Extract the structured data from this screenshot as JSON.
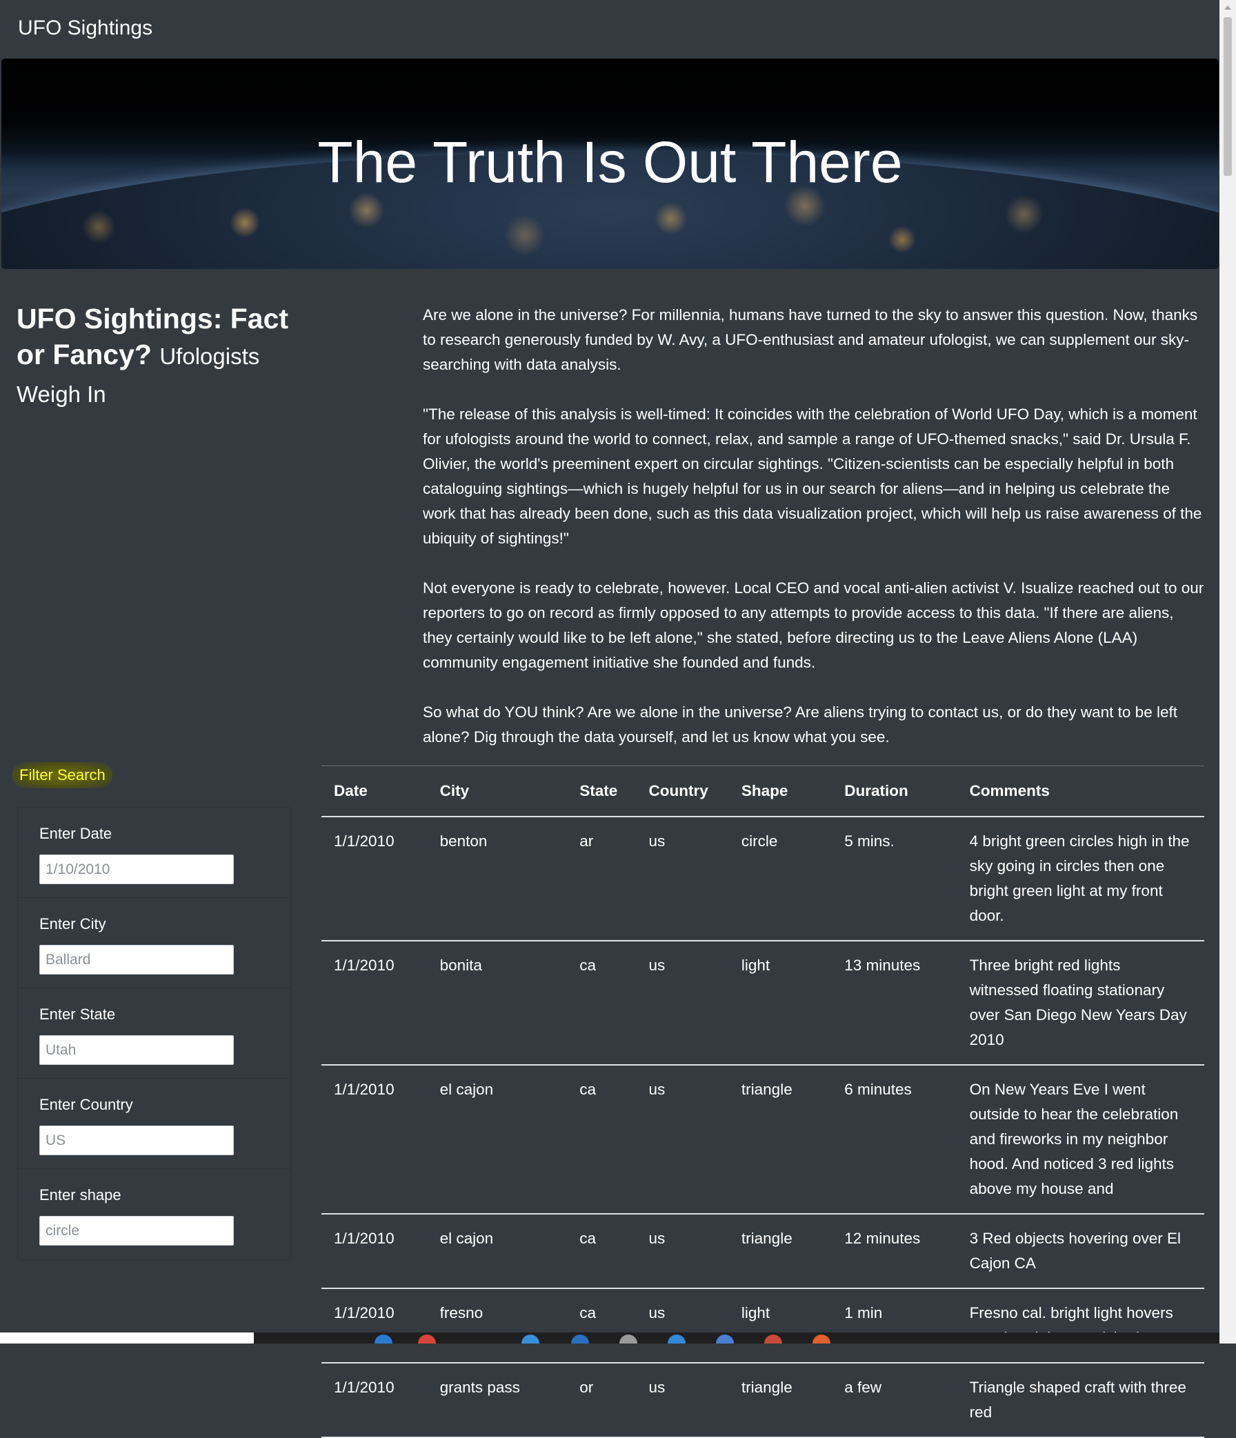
{
  "navbar": {
    "brand": "UFO Sightings"
  },
  "hero": {
    "title": "The Truth Is Out There"
  },
  "left": {
    "heading": "UFO Sightings: Fact or Fancy?",
    "subheading": "Ufologists Weigh In"
  },
  "article": {
    "paragraphs": [
      "Are we alone in the universe? For millennia, humans have turned to the sky to answer this question. Now, thanks to research generously funded by W. Avy, a UFO-enthusiast and amateur ufologist, we can supplement our sky-searching with data analysis.",
      "\"The release of this analysis is well-timed: It coincides with the celebration of World UFO Day, which is a moment for ufologists around the world to connect, relax, and sample a range of UFO-themed snacks,\" said Dr. Ursula F. Olivier, the world's preeminent expert on circular sightings. \"Citizen-scientists can be especially helpful in both cataloguing sightings—which is hugely helpful for us in our search for aliens—and in helping us celebrate the work that has already been done, such as this data visualization project, which will help us raise awareness of the ubiquity of sightings!\"",
      "Not everyone is ready to celebrate, however. Local CEO and vocal anti-alien activist V. Isualize reached out to our reporters to go on record as firmly opposed to any attempts to provide access to this data. \"If there are aliens, they certainly would like to be left alone,\" she stated, before directing us to the Leave Aliens Alone (LAA) community engagement initiative she founded and funds.",
      "So what do YOU think? Are we alone in the universe? Are aliens trying to contact us, or do they want to be left alone? Dig through the data yourself, and let us know what you see."
    ]
  },
  "filter": {
    "title": "Filter Search",
    "fields": [
      {
        "label": "Enter Date",
        "placeholder": "1/10/2010"
      },
      {
        "label": "Enter City",
        "placeholder": "Ballard"
      },
      {
        "label": "Enter State",
        "placeholder": "Utah"
      },
      {
        "label": "Enter Country",
        "placeholder": "US"
      },
      {
        "label": "Enter shape",
        "placeholder": "circle"
      }
    ]
  },
  "table": {
    "headers": [
      "Date",
      "City",
      "State",
      "Country",
      "Shape",
      "Duration",
      "Comments"
    ],
    "rows": [
      [
        "1/1/2010",
        "benton",
        "ar",
        "us",
        "circle",
        "5 mins.",
        "4 bright green circles high in the sky going in circles then one bright green light at my front door."
      ],
      [
        "1/1/2010",
        "bonita",
        "ca",
        "us",
        "light",
        "13 minutes",
        "Three bright red lights witnessed floating stationary over San Diego New Years Day 2010"
      ],
      [
        "1/1/2010",
        "el cajon",
        "ca",
        "us",
        "triangle",
        "6 minutes",
        "On New Years Eve I went outside to hear the celebration and fireworks in my neighbor hood. And noticed 3 red lights above my house and"
      ],
      [
        "1/1/2010",
        "el cajon",
        "ca",
        "us",
        "triangle",
        "12 minutes",
        "3 Red objects hovering over El Cajon CA"
      ],
      [
        "1/1/2010",
        "fresno",
        "ca",
        "us",
        "light",
        "1 min",
        "Fresno cal. bright light hovers over head then vanished"
      ],
      [
        "1/1/2010",
        "grants pass",
        "or",
        "us",
        "triangle",
        "a few",
        "Triangle shaped craft with three red"
      ]
    ]
  },
  "colors": {
    "background": "#343a40",
    "highlight": "#ffff33",
    "text": "#ffffff"
  }
}
